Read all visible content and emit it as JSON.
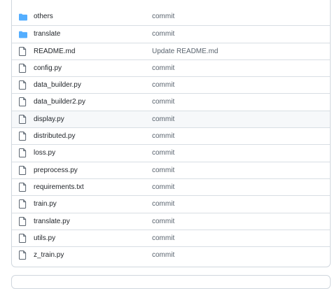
{
  "colors": {
    "folder_icon": "#54aeff",
    "file_icon": "#59636e",
    "border": "#d0d7de",
    "row_highlight": "#f6f8fa"
  },
  "files": [
    {
      "name": "others",
      "type": "folder",
      "icon": "folder-icon",
      "message": "commit"
    },
    {
      "name": "translate",
      "type": "folder",
      "icon": "folder-icon",
      "message": "commit"
    },
    {
      "name": "README.md",
      "type": "file",
      "icon": "file-icon",
      "message": "Update README.md"
    },
    {
      "name": "config.py",
      "type": "file",
      "icon": "file-icon",
      "message": "commit"
    },
    {
      "name": "data_builder.py",
      "type": "file",
      "icon": "file-icon",
      "message": "commit"
    },
    {
      "name": "data_builder2.py",
      "type": "file",
      "icon": "file-icon",
      "message": "commit"
    },
    {
      "name": "display.py",
      "type": "file",
      "icon": "file-icon",
      "message": "commit"
    },
    {
      "name": "distributed.py",
      "type": "file",
      "icon": "file-icon",
      "message": "commit"
    },
    {
      "name": "loss.py",
      "type": "file",
      "icon": "file-icon",
      "message": "commit"
    },
    {
      "name": "preprocess.py",
      "type": "file",
      "icon": "file-icon",
      "message": "commit"
    },
    {
      "name": "requirements.txt",
      "type": "file",
      "icon": "file-icon",
      "message": "commit"
    },
    {
      "name": "train.py",
      "type": "file",
      "icon": "file-icon",
      "message": "commit"
    },
    {
      "name": "translate.py",
      "type": "file",
      "icon": "file-icon",
      "message": "commit"
    },
    {
      "name": "utils.py",
      "type": "file",
      "icon": "file-icon",
      "message": "commit"
    },
    {
      "name": "z_train.py",
      "type": "file",
      "icon": "file-icon",
      "message": "commit"
    }
  ]
}
